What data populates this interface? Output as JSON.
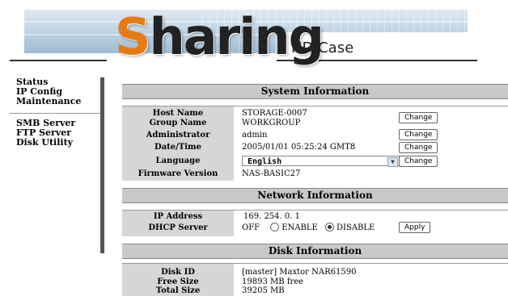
{
  "header": {
    "logo_first": "S",
    "logo_rest": "haring",
    "subtitle": "HD Case"
  },
  "sidebar": {
    "items": [
      {
        "label": "Status"
      },
      {
        "label": "IP Config"
      },
      {
        "label": "Maintenance"
      },
      {
        "label": "SMB Server"
      },
      {
        "label": "FTP Server"
      },
      {
        "label": "Disk Utility"
      }
    ]
  },
  "system": {
    "title": "System Information",
    "host_name_label": "Host Name",
    "host_name_value": "STORAGE-0007",
    "group_name_label": "Group Name",
    "group_name_value": "WORKGROUP",
    "administrator_label": "Administrator",
    "administrator_value": "admin",
    "datetime_label": "Date/Time",
    "datetime_value": "2005/01/01 05:25:24 GMT8",
    "language_label": "Language",
    "language_value": "English",
    "firmware_label": "Firmware Version",
    "firmware_value": "NAS-BASIC27",
    "change_label": "Change"
  },
  "network": {
    "title": "Network Information",
    "ip_label": "IP Address",
    "ip_value": "169. 254. 0. 1",
    "dhcp_label": "DHCP Server",
    "dhcp_state": "OFF",
    "enable_label": "ENABLE",
    "disable_label": "DISABLE",
    "selected": "DISABLE",
    "apply_label": "Apply"
  },
  "disk": {
    "title": "Disk Information",
    "disk_id_label": "Disk ID",
    "disk_id_value": "[master] Maxtor NAR61590",
    "free_size_label": "Free Size",
    "free_size_value": "19893 MB free",
    "total_size_label": "Total Size",
    "total_size_value": "39205 MB"
  },
  "colors": {
    "logo_accent": "#e87a14",
    "section_header_bg": "#c9c9c9",
    "label_column_bg": "#d6d6d6",
    "sidebar_bar": "#555555"
  }
}
